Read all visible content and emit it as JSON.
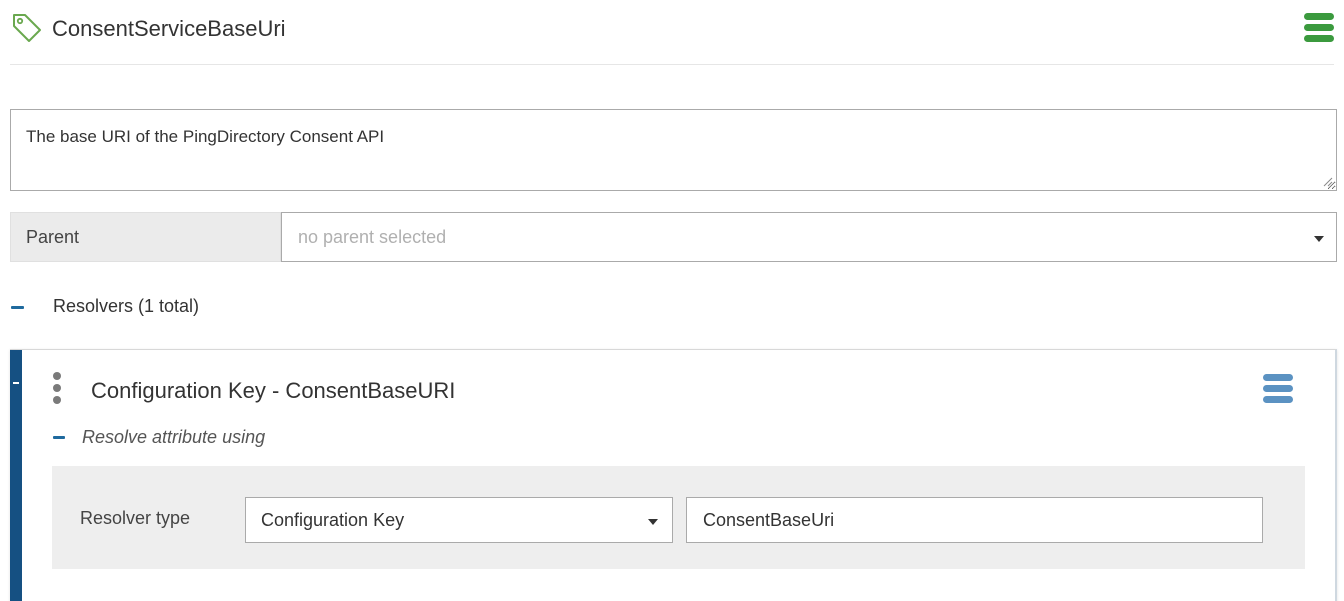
{
  "colors": {
    "header_icon_green": "#6aa84f",
    "header_menu_green": "#3b9a3e",
    "accent_blue": "#1f6a9e",
    "card_bar_blue": "#155082",
    "card_menu_blue": "#5b92c2"
  },
  "header": {
    "icon": "tag-icon",
    "title": "ConsentServiceBaseUri",
    "menu_icon": "hamburger-menu-icon"
  },
  "description": {
    "value": "The base URI of the PingDirectory Consent API"
  },
  "parent": {
    "label": "Parent",
    "placeholder": "no parent selected"
  },
  "resolvers": {
    "heading": "Resolvers (1 total)",
    "items": [
      {
        "title": "Configuration Key - ConsentBaseURI",
        "resolve_label": "Resolve attribute using",
        "resolver_type_label": "Resolver type",
        "resolver_type_value": "Configuration Key",
        "resolver_value": "ConsentBaseUri"
      }
    ]
  }
}
